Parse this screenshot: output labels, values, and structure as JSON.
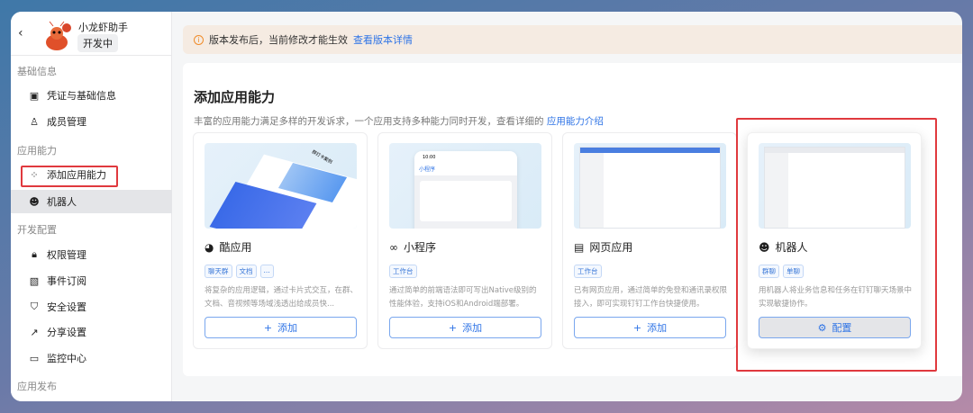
{
  "sidebar": {
    "back_icon": "chevron-left-icon",
    "app_name": "小龙虾助手",
    "status_badge": "开发中",
    "sections": [
      {
        "label": "基础信息",
        "items": [
          {
            "label": "凭证与基础信息",
            "icon": "credential-icon"
          },
          {
            "label": "成员管理",
            "icon": "user-icon"
          }
        ]
      },
      {
        "label": "应用能力",
        "items": [
          {
            "label": "添加应用能力",
            "icon": "apps-add-icon"
          },
          {
            "label": "机器人",
            "icon": "robot-icon",
            "active": true
          }
        ]
      },
      {
        "label": "开发配置",
        "items": [
          {
            "label": "权限管理",
            "icon": "lock-icon"
          },
          {
            "label": "事件订阅",
            "icon": "rss-icon"
          },
          {
            "label": "安全设置",
            "icon": "shield-icon"
          },
          {
            "label": "分享设置",
            "icon": "share-icon"
          },
          {
            "label": "监控中心",
            "icon": "monitor-icon"
          }
        ]
      },
      {
        "label": "应用发布",
        "items": []
      }
    ]
  },
  "banner": {
    "text": "版本发布后，当前修改才能生效",
    "link": "查看版本详情",
    "icon": "info-icon",
    "color": "#f08c2a"
  },
  "main": {
    "title": "添加应用能力",
    "subtitle": "丰富的应用能力满足多样的开发诉求，一个应用支持多种能力同时开发，查看详细的",
    "subtitle_link": "应用能力介绍",
    "cards": [
      {
        "title": "酷应用",
        "icon": "cool-app-icon",
        "tags": [
          "聊天群",
          "文档",
          "..."
        ],
        "desc": "将复杂的应用逻辑，通过卡片式交互，在群、文档、音视频等场域浅透出给成员快...",
        "button": "添加",
        "button_icon": "plus-icon",
        "preview_text": "群打卡案例"
      },
      {
        "title": "小程序",
        "icon": "infinity-icon",
        "tags": [
          "工作台"
        ],
        "desc": "通过简单的前端语法即可写出Native级别的性能体验，支持iOS和Android端部署。",
        "button": "添加",
        "button_icon": "plus-icon",
        "preview_time": "10:00",
        "preview_title": "小程序"
      },
      {
        "title": "网页应用",
        "icon": "browser-icon",
        "tags": [
          "工作台"
        ],
        "desc": "已有网页应用，通过简单的免登和通讯录权限接入，即可实现钉钉工作台快捷使用。",
        "button": "添加",
        "button_icon": "plus-icon"
      },
      {
        "title": "机器人",
        "icon": "robot-icon",
        "tags": [
          "群聊",
          "单聊"
        ],
        "desc": "用机器人将业务信息和任务在钉钉聊天场景中实现敏捷协作。",
        "button": "配置",
        "button_icon": "gear-icon"
      }
    ]
  },
  "colors": {
    "accent": "#2f74e6",
    "highlight": "#e0393e"
  }
}
